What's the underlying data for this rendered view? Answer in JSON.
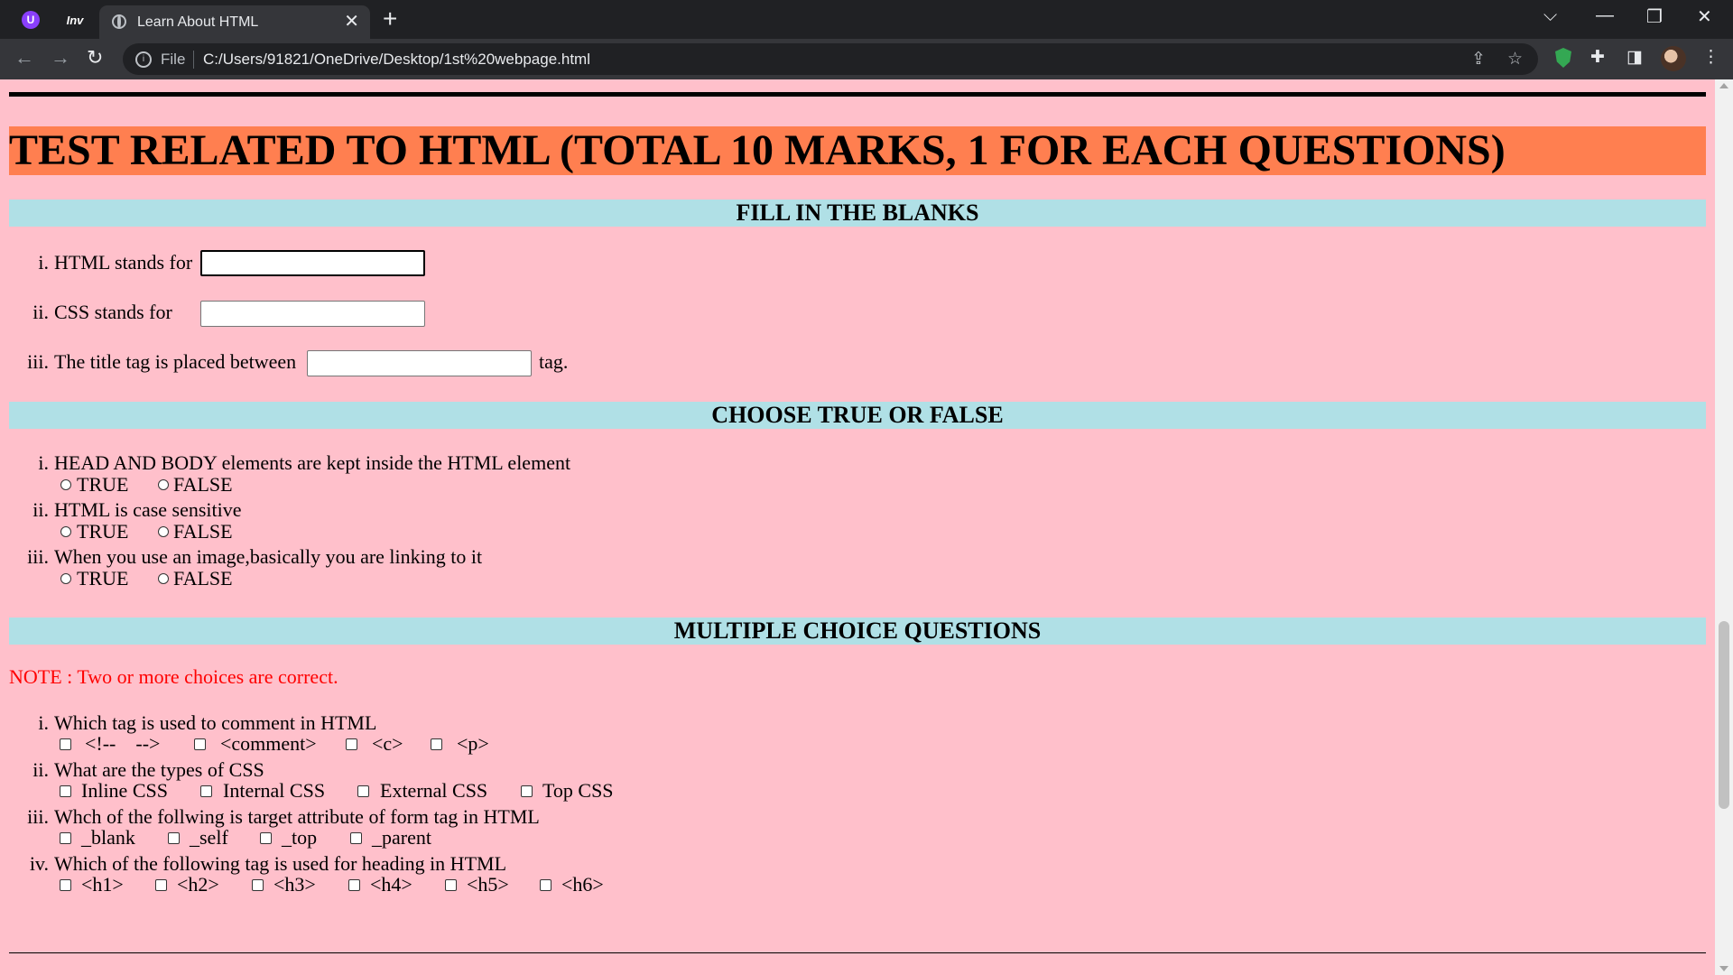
{
  "browser": {
    "tab_title": "Learn About HTML",
    "ext_u": "U",
    "ext_inv": "Inv",
    "file_label": "File",
    "url": "C:/Users/91821/OneDrive/Desktop/1st%20webpage.html"
  },
  "page": {
    "title": "TEST RELATED TO HTML (TOTAL 10 MARKS, 1 FOR EACH QUESTIONS)",
    "fill": {
      "heading": "FILL IN THE BLANKS",
      "q1": {
        "num": "i.",
        "text": "HTML stands for",
        "value": ""
      },
      "q2": {
        "num": "ii.",
        "text": "CSS stands for",
        "value": ""
      },
      "q3": {
        "num": "iii.",
        "text": "The title tag is placed between",
        "value": "",
        "suffix": "tag."
      }
    },
    "truefalse": {
      "heading": "CHOOSE TRUE OR FALSE",
      "true_label": "TRUE",
      "false_label": "FALSE",
      "q1": {
        "num": "i.",
        "text": "HEAD AND BODY elements are kept inside the HTML element"
      },
      "q2": {
        "num": "ii.",
        "text": "HTML is case sensitive"
      },
      "q3": {
        "num": "iii.",
        "text": "When you use an image,basically you are linking to it"
      }
    },
    "mcq": {
      "heading": "MULTIPLE CHOICE QUESTIONS",
      "note": "NOTE : Two or more choices are correct.",
      "q1": {
        "num": "i.",
        "text": "Which tag is used to comment in HTML",
        "options": [
          "<!--    -->",
          "<comment>",
          "<c>",
          "<p>"
        ]
      },
      "q2": {
        "num": "ii.",
        "text": "What are the types of CSS",
        "options": [
          "Inline CSS",
          "Internal CSS",
          "External CSS",
          "Top CSS"
        ]
      },
      "q3": {
        "num": "iii.",
        "text": "Whch of the follwing is target attribute of form tag in HTML",
        "options": [
          "_blank",
          "_self",
          "_top",
          "_parent"
        ]
      },
      "q4": {
        "num": "iv.",
        "text": "Which of the following tag is used for heading in HTML",
        "options": [
          "<h1>",
          "<h2>",
          "<h3>",
          "<h4>",
          "<h5>",
          "<h6>"
        ]
      }
    }
  }
}
